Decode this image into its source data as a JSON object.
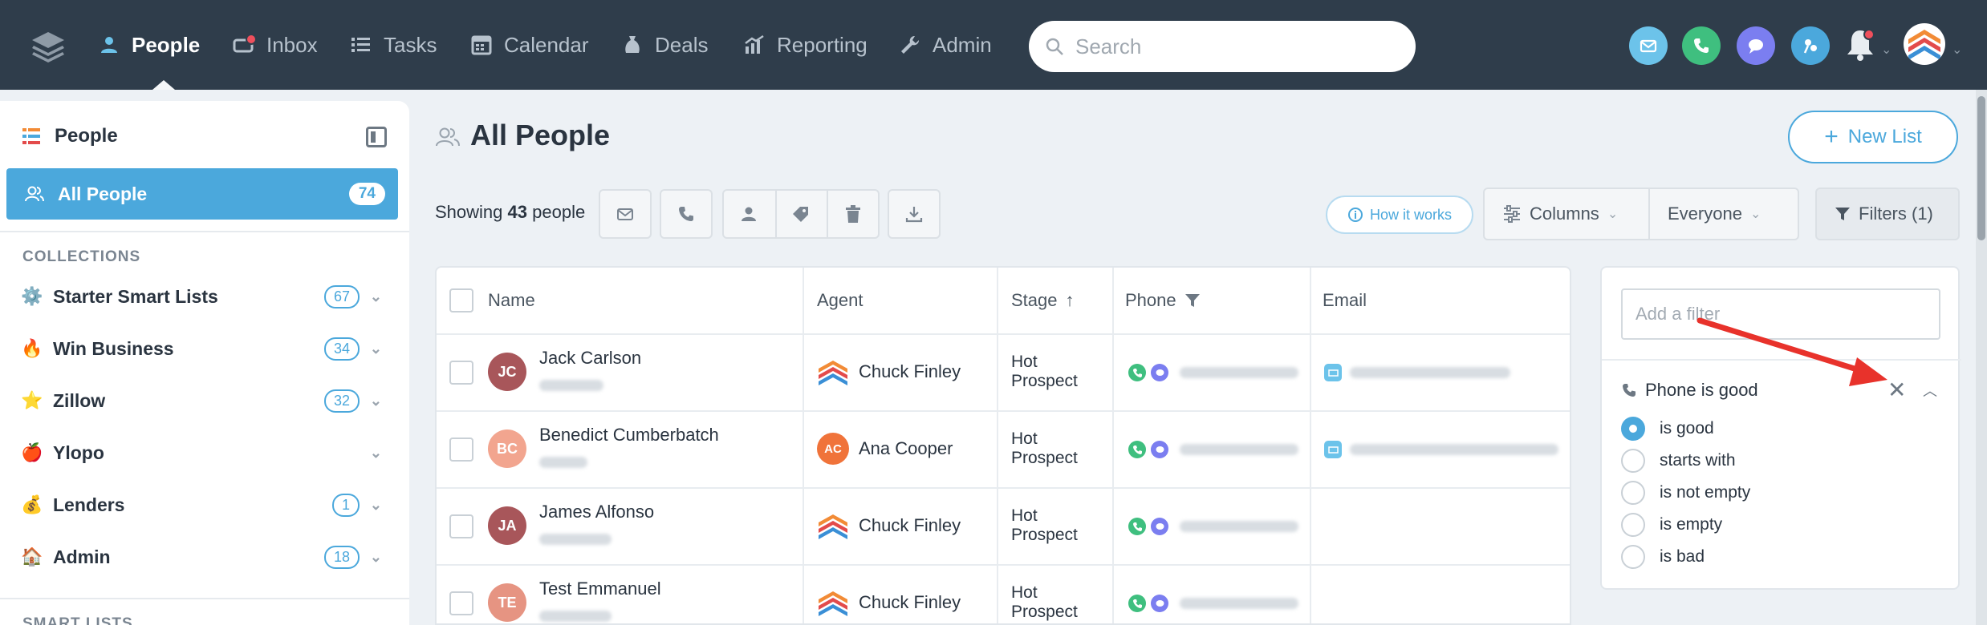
{
  "nav": {
    "items": [
      {
        "label": "People",
        "icon": "person-icon",
        "active": true
      },
      {
        "label": "Inbox",
        "icon": "inbox-icon"
      },
      {
        "label": "Tasks",
        "icon": "tasks-list-icon"
      },
      {
        "label": "Calendar",
        "icon": "calendar-icon"
      },
      {
        "label": "Deals",
        "icon": "money-bag-icon"
      },
      {
        "label": "Reporting",
        "icon": "chart-icon"
      },
      {
        "label": "Admin",
        "icon": "wrench-icon"
      }
    ],
    "search_placeholder": "Search",
    "colors": {
      "bar": "#2f3d4b",
      "email": "#6cc3ea",
      "call": "#3fbf7f",
      "chat": "#7b7ef0",
      "apps": "#4ba8dc",
      "notification_dot": "#ef4f5c"
    }
  },
  "sidebar": {
    "title": "People",
    "all_people": {
      "label": "All People",
      "count": "74"
    },
    "collections_heading": "COLLECTIONS",
    "collections": [
      {
        "label": "Starter Smart Lists",
        "icon": "gear-icon",
        "count": "67"
      },
      {
        "label": "Win Business",
        "icon": "fire-icon",
        "count": "34"
      },
      {
        "label": "Zillow",
        "icon": "star-icon",
        "count": "32"
      },
      {
        "label": "Ylopo",
        "icon": "apple-icon",
        "count": ""
      },
      {
        "label": "Lenders",
        "icon": "money-bag-icon",
        "count": "1"
      },
      {
        "label": "Admin",
        "icon": "house-icon",
        "count": "18"
      }
    ],
    "smart_lists_heading": "SMART LISTS",
    "accent": "#4ba8dc"
  },
  "main": {
    "title": "All People",
    "new_list_label": "New List",
    "showing_prefix": "Showing",
    "showing_count": "43",
    "showing_suffix": "people",
    "how_it_works": "How it works",
    "columns_label": "Columns",
    "everyone_label": "Everyone",
    "filters_label": "Filters (1)"
  },
  "table": {
    "headers": {
      "name": "Name",
      "agent": "Agent",
      "stage": "Stage",
      "phone": "Phone",
      "email": "Email"
    },
    "rows": [
      {
        "initials": "JC",
        "name": "Jack Carlson",
        "agent": "Chuck Finley",
        "stage_line1": "Hot",
        "stage_line2": "Prospect",
        "avatar_color": "#a8565a",
        "agent_type": "logo",
        "has_email": true
      },
      {
        "initials": "BC",
        "name": "Benedict Cumberbatch",
        "agent": "Ana Cooper",
        "stage_line1": "Hot",
        "stage_line2": "Prospect",
        "avatar_color": "#f2a58f",
        "agent_type": "avatar",
        "agent_initials": "AC",
        "has_email": true
      },
      {
        "initials": "JA",
        "name": "James Alfonso",
        "agent": "Chuck Finley",
        "stage_line1": "Hot",
        "stage_line2": "Prospect",
        "avatar_color": "#a8565a",
        "agent_type": "logo",
        "has_email": false
      },
      {
        "initials": "TE",
        "name": "Test Emmanuel",
        "agent": "Chuck Finley",
        "stage_line1": "Hot",
        "stage_line2": "Prospect",
        "avatar_color": "#e69482",
        "agent_type": "logo",
        "has_email": false
      }
    ]
  },
  "filter_panel": {
    "add_placeholder": "Add a filter",
    "active_filter": "Phone is good",
    "options": [
      {
        "label": "is good",
        "selected": true
      },
      {
        "label": "starts with",
        "selected": false
      },
      {
        "label": "is not empty",
        "selected": false
      },
      {
        "label": "is empty",
        "selected": false
      },
      {
        "label": "is bad",
        "selected": false
      }
    ]
  },
  "annotation": {
    "arrow_color": "#e8322b"
  }
}
